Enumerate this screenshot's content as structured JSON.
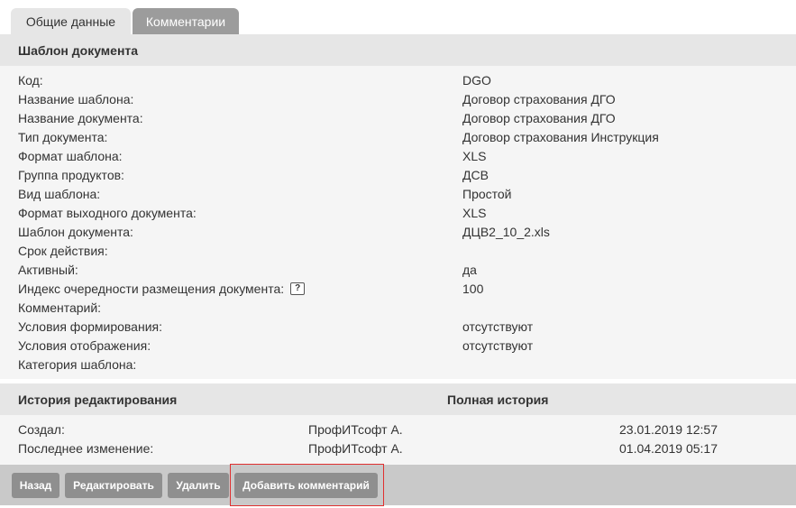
{
  "tabs": [
    {
      "label": "Общие данные",
      "active": true
    },
    {
      "label": "Комментарии",
      "active": false
    }
  ],
  "template_section": {
    "title": "Шаблон документа",
    "fields": [
      {
        "label": "Код:",
        "value": "DGO"
      },
      {
        "label": "Название шаблона:",
        "value": "Договор страхования ДГО"
      },
      {
        "label": "Название документа:",
        "value": "Договор страхования ДГО"
      },
      {
        "label": "Тип документа:",
        "value": "Договор страхования Инструкция"
      },
      {
        "label": "Формат шаблона:",
        "value": "XLS"
      },
      {
        "label": "Группа продуктов:",
        "value": "ДСВ"
      },
      {
        "label": "Вид шаблона:",
        "value": "Простой"
      },
      {
        "label": "Формат выходного документа:",
        "value": "XLS"
      },
      {
        "label": "Шаблон документа:",
        "value": "ДЦВ2_10_2.xls"
      },
      {
        "label": "Срок действия:",
        "value": ""
      },
      {
        "label": "Активный:",
        "value": "да"
      },
      {
        "label": "Индекс очередности размещения документа:",
        "value": "100",
        "help": "?"
      },
      {
        "label": "Комментарий:",
        "value": ""
      },
      {
        "label": "Условия формирования:",
        "value": "отсутствуют"
      },
      {
        "label": "Условия отображения:",
        "value": "отсутствуют"
      },
      {
        "label": "Категория шаблона:",
        "value": ""
      }
    ]
  },
  "history_section": {
    "title": "История редактирования",
    "full_history_link": "Полная история",
    "rows": [
      {
        "label": "Создал:",
        "user": "ПрофИТсофт А.",
        "date": "23.01.2019 12:57"
      },
      {
        "label": "Последнее изменение:",
        "user": "ПрофИТсофт А.",
        "date": "01.04.2019 05:17"
      }
    ]
  },
  "toolbar": {
    "back_label": "Назад",
    "edit_label": "Редактировать",
    "delete_label": "Удалить",
    "add_comment_label": "Добавить комментарий"
  },
  "colors": {
    "tab_active_bg": "#e6e6e6",
    "tab_inactive_bg": "#9c9c9c",
    "button_bg": "#8f8f8f",
    "toolbar_bg": "#c9c9c9",
    "highlight_border": "#e03030"
  }
}
